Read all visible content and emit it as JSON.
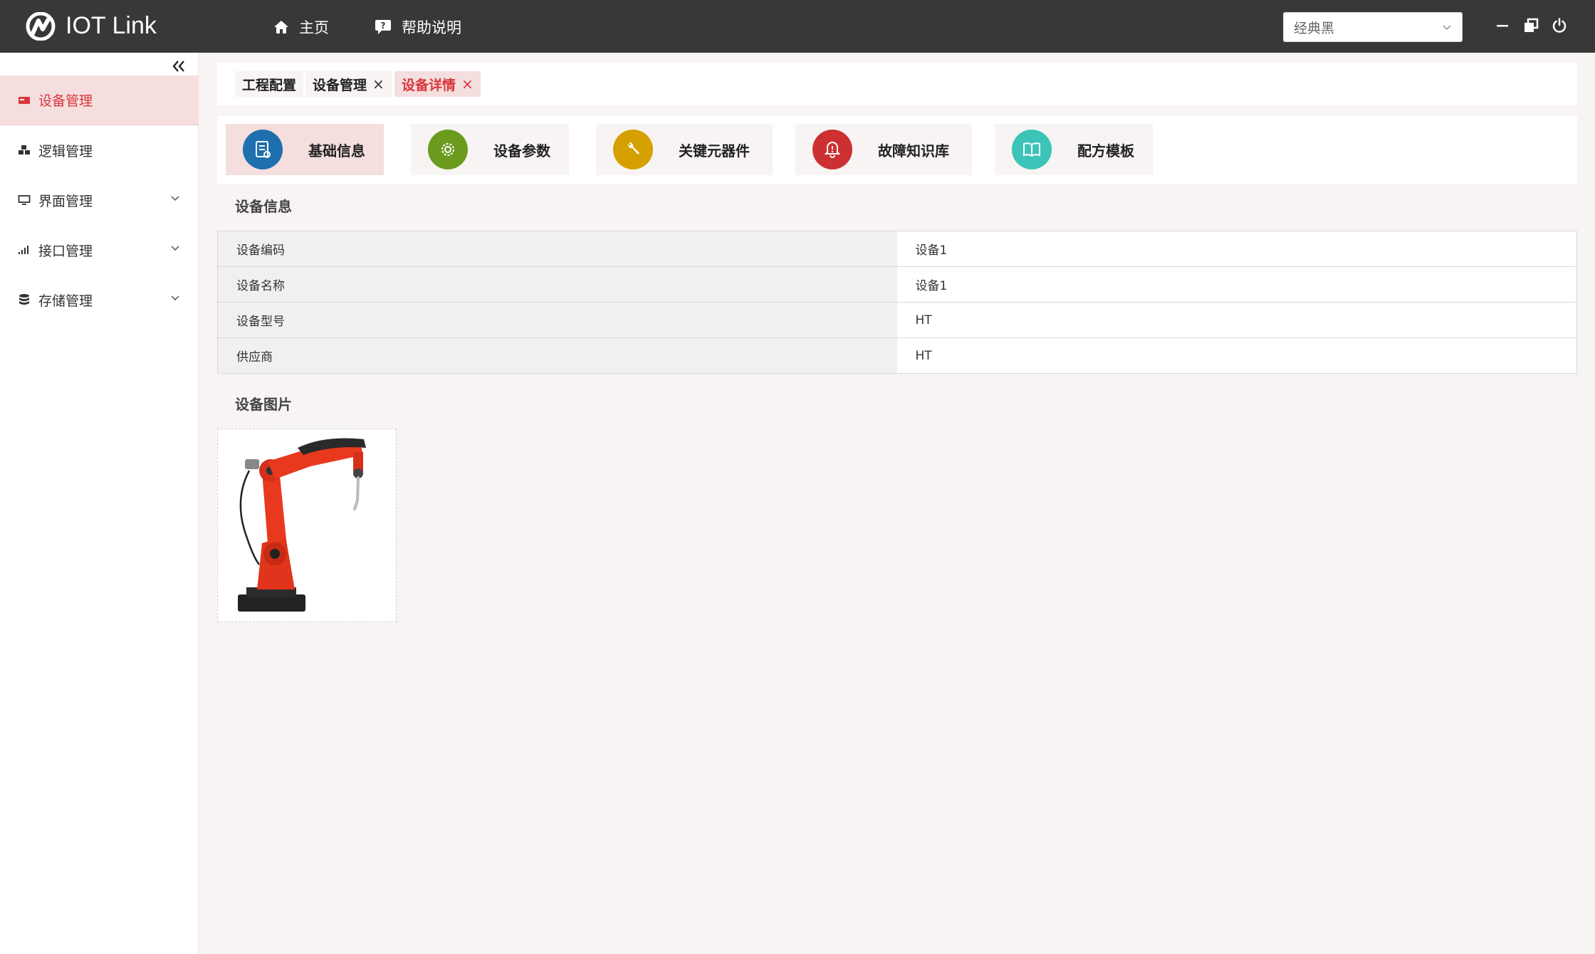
{
  "header": {
    "app_title": "IOT Link",
    "nav": [
      {
        "label": "主页",
        "icon": "home-icon"
      },
      {
        "label": "帮助说明",
        "icon": "help-icon"
      }
    ],
    "theme_select": {
      "value": "经典黑"
    },
    "window_controls": [
      "minimize-icon",
      "restore-icon",
      "power-icon"
    ]
  },
  "sidebar": {
    "items": [
      {
        "label": "设备管理",
        "icon": "device-icon",
        "active": true
      },
      {
        "label": "逻辑管理",
        "icon": "cubes-icon"
      },
      {
        "label": "界面管理",
        "icon": "monitor-icon",
        "expandable": true
      },
      {
        "label": "接口管理",
        "icon": "signal-icon",
        "expandable": true
      },
      {
        "label": "存储管理",
        "icon": "database-icon",
        "expandable": true
      }
    ]
  },
  "tabs": [
    {
      "label": "工程配置"
    },
    {
      "label": "设备管理",
      "close": "×"
    },
    {
      "label": "设备详情",
      "close": "×",
      "active": true
    }
  ],
  "tiles": [
    {
      "label": "基础信息",
      "icon": "document-icon",
      "color": "#1e6fae",
      "active": true
    },
    {
      "label": "设备参数",
      "icon": "gear-icon",
      "color": "#6a9b1f"
    },
    {
      "label": "关键元器件",
      "icon": "wrench-icon",
      "color": "#d6a000"
    },
    {
      "label": "故障知识库",
      "icon": "bell-alert-icon",
      "color": "#cc3033"
    },
    {
      "label": "配方模板",
      "icon": "book-icon",
      "color": "#3cc4b8"
    }
  ],
  "device_info": {
    "title": "设备信息",
    "rows": [
      {
        "key": "设备编码",
        "value": "设备1"
      },
      {
        "key": "设备名称",
        "value": "设备1"
      },
      {
        "key": "设备型号",
        "value": "HT"
      },
      {
        "key": "供应商",
        "value": "HT"
      }
    ]
  },
  "device_image": {
    "title": "设备图片",
    "icon": "industrial-robot-arm-image"
  },
  "colors": {
    "topbar": "#383838",
    "accent": "#d9363e",
    "active_bg": "#f5dede"
  }
}
